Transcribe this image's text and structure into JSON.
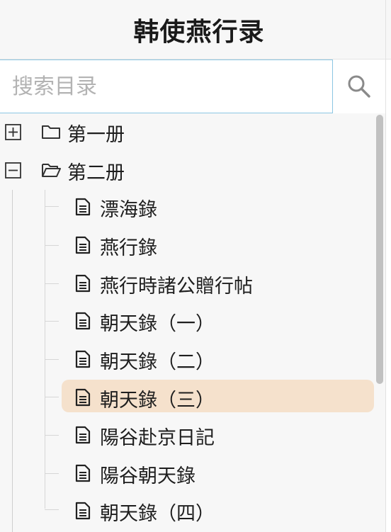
{
  "header": {
    "title": "韩使燕行录"
  },
  "search": {
    "placeholder": "搜索目录",
    "value": ""
  },
  "tree": {
    "volumes": [
      {
        "label": "第一册",
        "expanded": false,
        "toggle_icon": "plus-square-icon",
        "folder_icon": "folder-closed-icon"
      },
      {
        "label": "第二册",
        "expanded": true,
        "toggle_icon": "minus-square-icon",
        "folder_icon": "folder-open-icon"
      }
    ],
    "items": [
      {
        "label": "漂海錄",
        "icon": "document-icon",
        "selected": false
      },
      {
        "label": "燕行錄",
        "icon": "document-icon",
        "selected": false
      },
      {
        "label": "燕行時諸公贈行帖",
        "icon": "document-icon",
        "selected": false
      },
      {
        "label": "朝天錄（一）",
        "icon": "document-icon",
        "selected": false
      },
      {
        "label": "朝天錄（二）",
        "icon": "document-icon",
        "selected": false
      },
      {
        "label": "朝天錄（三）",
        "icon": "document-icon",
        "selected": true
      },
      {
        "label": "陽谷赴京日記",
        "icon": "document-icon",
        "selected": false
      },
      {
        "label": "陽谷朝天錄",
        "icon": "document-icon",
        "selected": false
      },
      {
        "label": "朝天錄（四）",
        "icon": "document-icon",
        "selected": false
      }
    ]
  },
  "colors": {
    "selected_bg": "#f5e1cc",
    "search_border": "#8cc6e3",
    "panel_bg": "#f7f7f7"
  }
}
